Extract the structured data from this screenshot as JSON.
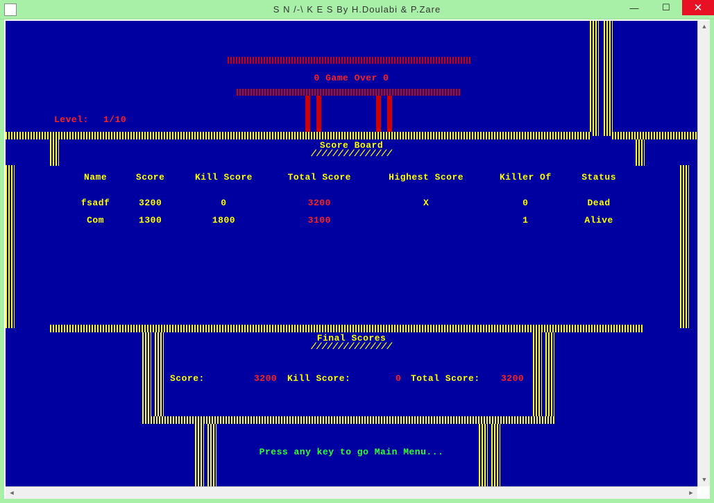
{
  "window": {
    "title": "S N /-\\ K E S  By H.Doulabi & P.Zare"
  },
  "game_over": "0 Game Over 0",
  "level_label": "Level:",
  "level_value": "1/10",
  "scoreboard_title": "Score Board",
  "scoreboard": {
    "headers": [
      "Name",
      "Score",
      "Kill Score",
      "Total Score",
      "Highest Score",
      "Killer Of",
      "Status"
    ],
    "rows": [
      {
        "name": "fsadf",
        "score": "3200",
        "kill_score": "0",
        "total": "3200",
        "highest": "X",
        "killer_of": "0",
        "status": "Dead"
      },
      {
        "name": "Com",
        "score": "1300",
        "kill_score": "1800",
        "total": "3100",
        "highest": "",
        "killer_of": "1",
        "status": "Alive"
      }
    ]
  },
  "final_scores_title": "Final Scores",
  "final": {
    "score_label": "Score:",
    "score_value": "3200",
    "kill_label": "Kill Score:",
    "kill_value": "0",
    "total_label": "Total Score:",
    "total_value": "3200"
  },
  "prompt": "Press any key to go Main Menu..."
}
